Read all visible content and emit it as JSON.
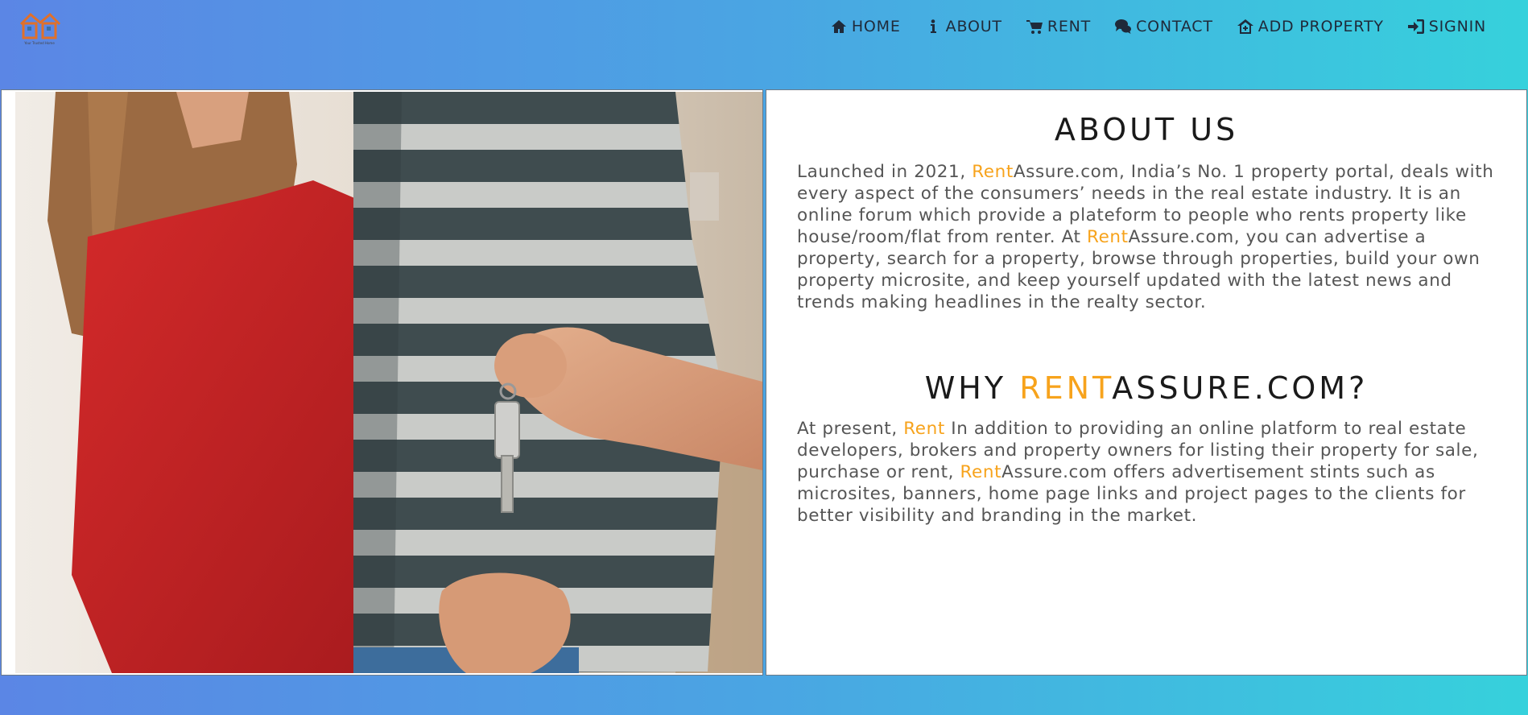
{
  "logo": {
    "name": "logo-icon",
    "tagline": "Your Trusted Home"
  },
  "nav": [
    {
      "label": "HOME",
      "icon": "home-icon"
    },
    {
      "label": "ABOUT",
      "icon": "info-icon"
    },
    {
      "label": "RENT",
      "icon": "cart-icon"
    },
    {
      "label": "CONTACT",
      "icon": "chat-icon"
    },
    {
      "label": "ADD PROPERTY",
      "icon": "house-plus-icon"
    },
    {
      "label": "SIGNIN",
      "icon": "signin-icon"
    }
  ],
  "photo": {
    "name": "key-handover-photo"
  },
  "about": {
    "title": "ABOUT US",
    "p1_a": "Launched in 2021, ",
    "p1_brand": "Rent",
    "p1_b": "Assure.com, India’s No. 1 property portal, deals with every aspect of the consumers’ needs in the real estate industry. It is an online forum which provide a plateform to people who rents property like house/room/flat from renter. At ",
    "p1_brand2": "Rent",
    "p1_c": "Assure.com, you can advertise a property, search for a property, browse through properties, build your own property microsite, and keep yourself updated with the latest news and trends making headlines in the realty sector."
  },
  "why": {
    "title_a": "WHY ",
    "title_brand": "RENT",
    "title_b": "ASSURE.COM?",
    "p_a": "At present, ",
    "p_brand": "Rent",
    "p_b": " In addition to providing an online platform to real estate developers, brokers and property owners for listing their property for sale, purchase or rent, ",
    "p_brand2": "Rent",
    "p_c": "Assure.com offers advertisement stints such as microsites, banners, home page links and project pages to the clients for better visibility and branding in the market."
  },
  "colors": {
    "accent": "#f7a31c",
    "gradient_start": "#5b86e5",
    "gradient_end": "#36d1dc"
  }
}
